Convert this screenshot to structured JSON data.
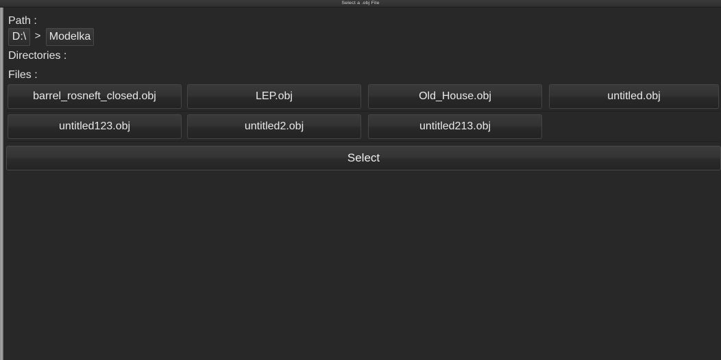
{
  "window": {
    "title": "Select a .obj File"
  },
  "path_section": {
    "label": "Path :",
    "crumbs": [
      {
        "label": "D:\\"
      },
      {
        "label": "Modelka"
      }
    ],
    "separator": ">"
  },
  "directories_section": {
    "label": "Directories :",
    "items": []
  },
  "files_section": {
    "label": "Files :",
    "rows": [
      [
        {
          "name": "barrel_rosneft_closed.obj"
        },
        {
          "name": "LEP.obj"
        },
        {
          "name": "Old_House.obj"
        },
        {
          "name": "untitled.obj"
        }
      ],
      [
        {
          "name": "untitled123.obj"
        },
        {
          "name": "untitled2.obj"
        },
        {
          "name": "untitled213.obj"
        }
      ]
    ]
  },
  "actions": {
    "select_label": "Select"
  },
  "colors": {
    "window_background": "#282828",
    "titlebar_background": "#343434",
    "button_face": "#323232",
    "button_border": "#454545",
    "text": "#e2e2e2",
    "edge_stripe": "#a8a8a8"
  }
}
